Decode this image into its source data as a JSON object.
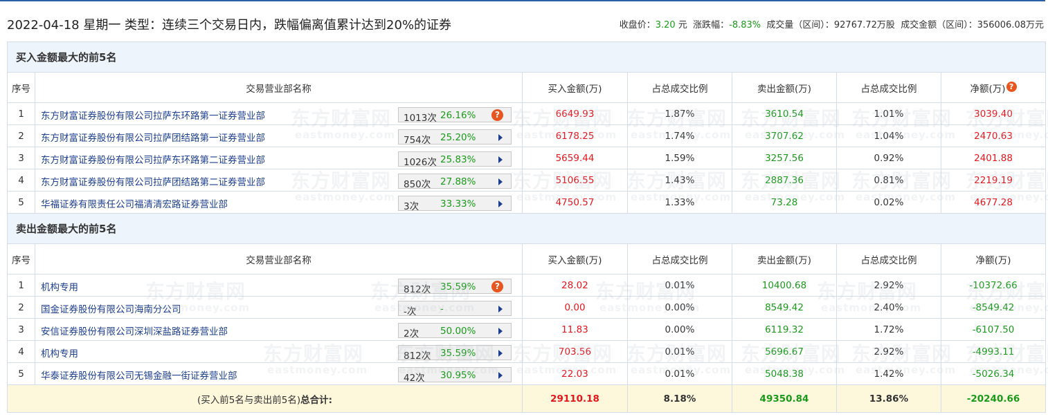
{
  "header": {
    "title": "2022-04-18 星期一 类型：连续三个交易日内，跌幅偏离值累计达到20%的证券",
    "close_label": "收盘价：",
    "close_value": "3.20",
    "close_unit": " 元",
    "change_label": "涨跌幅：",
    "change_value": "-8.83%",
    "volume_text": "成交量（区间）：92767.72万股",
    "amount_text": "成交金额（区间）：356006.08万元"
  },
  "columns": {
    "no": "序号",
    "name": "交易营业部名称",
    "buy": "买入金额(万)",
    "buy_ratio": "占总成交比例",
    "sell": "卖出金额(万)",
    "sell_ratio": "占总成交比例",
    "net": "净额(万)"
  },
  "buy_section": {
    "title": "买入金额最大的前5名",
    "rows": [
      {
        "no": "1",
        "name": "东方财富证券股份有限公司拉萨东环路第一证券营业部",
        "count": "1013次",
        "pct": "26.16%",
        "buy": "6649.93",
        "buy_ratio": "1.87%",
        "sell": "3610.54",
        "sell_ratio": "1.01%",
        "net": "3039.40"
      },
      {
        "no": "2",
        "name": "东方财富证券股份有限公司拉萨团结路第一证券营业部",
        "count": "754次",
        "pct": "25.20%",
        "buy": "6178.25",
        "buy_ratio": "1.74%",
        "sell": "3707.62",
        "sell_ratio": "1.04%",
        "net": "2470.63"
      },
      {
        "no": "3",
        "name": "东方财富证券股份有限公司拉萨东环路第二证券营业部",
        "count": "1026次",
        "pct": "25.83%",
        "buy": "5659.44",
        "buy_ratio": "1.59%",
        "sell": "3257.56",
        "sell_ratio": "0.92%",
        "net": "2401.88"
      },
      {
        "no": "4",
        "name": "东方财富证券股份有限公司拉萨团结路第二证券营业部",
        "count": "850次",
        "pct": "27.88%",
        "buy": "5106.55",
        "buy_ratio": "1.43%",
        "sell": "2887.36",
        "sell_ratio": "0.81%",
        "net": "2219.19"
      },
      {
        "no": "5",
        "name": "华福证券有限责任公司福清清宏路证券营业部",
        "count": "3次",
        "pct": "33.33%",
        "buy": "4750.57",
        "buy_ratio": "1.33%",
        "sell": "73.28",
        "sell_ratio": "0.02%",
        "net": "4677.28"
      }
    ]
  },
  "sell_section": {
    "title": "卖出金额最大的前5名",
    "rows": [
      {
        "no": "1",
        "name": "机构专用",
        "count": "812次",
        "pct": "35.59%",
        "buy": "28.02",
        "buy_ratio": "0.01%",
        "sell": "10400.68",
        "sell_ratio": "2.92%",
        "net": "-10372.66"
      },
      {
        "no": "2",
        "name": "国金证券股份有限公司海南分公司",
        "count": "-次",
        "pct": "-",
        "buy": "0.00",
        "buy_ratio": "0.00%",
        "sell": "8549.42",
        "sell_ratio": "2.40%",
        "net": "-8549.42"
      },
      {
        "no": "3",
        "name": "安信证券股份有限公司深圳深盐路证券营业部",
        "count": "2次",
        "pct": "50.00%",
        "buy": "11.83",
        "buy_ratio": "0.00%",
        "sell": "6119.32",
        "sell_ratio": "1.72%",
        "net": "-6107.50"
      },
      {
        "no": "4",
        "name": "机构专用",
        "count": "812次",
        "pct": "35.59%",
        "buy": "703.56",
        "buy_ratio": "0.01%",
        "sell": "5696.67",
        "sell_ratio": "2.92%",
        "net": "-4993.11"
      },
      {
        "no": "5",
        "name": "华泰证券股份有限公司无锡金融一街证券营业部",
        "count": "42次",
        "pct": "30.95%",
        "buy": "22.03",
        "buy_ratio": "0.01%",
        "sell": "5048.38",
        "sell_ratio": "1.42%",
        "net": "-5026.34"
      }
    ]
  },
  "total": {
    "label_prefix": "(买入前5名与卖出前5名)",
    "label_bold": "总合计:",
    "buy": "29110.18",
    "buy_ratio": "8.18%",
    "sell": "49350.84",
    "sell_ratio": "13.86%",
    "net": "-20240.66"
  },
  "watermark": {
    "cn": "东方财富网",
    "en": "eastmoney.com"
  },
  "colors": {
    "up": "#e4151b",
    "down": "#1a9a1a",
    "link": "#1d3f8f",
    "header_bg": "#eef4fb",
    "total_bg": "#fdf7dc"
  }
}
